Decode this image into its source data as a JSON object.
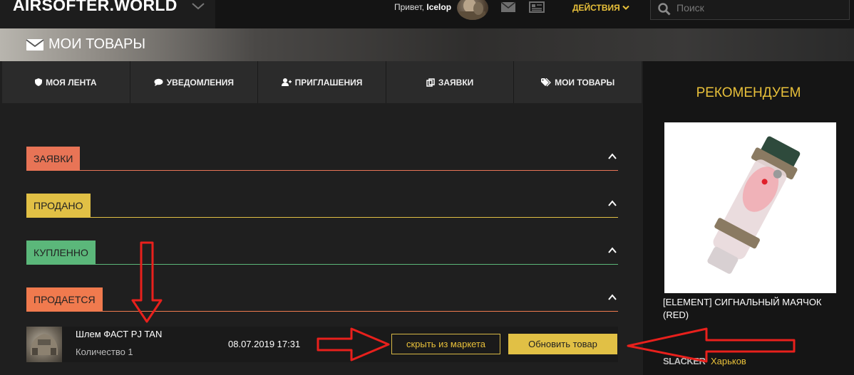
{
  "header": {
    "logo": "AIRSOFTER.WORLD",
    "greeting": "Привет,",
    "username": "Icelop",
    "actions_label": "ДЕЙСТВИЯ",
    "search_placeholder": "Поиск"
  },
  "banner": {
    "title": "МОИ ТОВАРЫ"
  },
  "tabs": [
    {
      "label": "МОЯ ЛЕНТА",
      "icon": "shield-icon"
    },
    {
      "label": "УВЕДОМЛЕНИЯ",
      "icon": "chat-icon"
    },
    {
      "label": "ПРИГЛАШЕНИЯ",
      "icon": "user-plus-icon"
    },
    {
      "label": "ЗАЯВКИ",
      "icon": "copy-icon"
    },
    {
      "label": "МОИ ТОВАРЫ",
      "icon": "tags-icon"
    }
  ],
  "sections": [
    {
      "label": "ЗАЯВКИ",
      "color": "#e87456"
    },
    {
      "label": "ПРОДАНО",
      "color": "#e1c045"
    },
    {
      "label": "КУПЛЕННО",
      "color": "#5bb77a"
    },
    {
      "label": "ПРОДАЕТСЯ",
      "color": "#f07a4e"
    }
  ],
  "item": {
    "name": "Шлем ФАСТ PJ TAN",
    "quantity": "Количество 1",
    "date": "08.07.2019 17:31",
    "hide_button": "скрыть из маркета",
    "update_button": "Обновить товар"
  },
  "sidebar": {
    "title": "РЕКОМЕНДУЕМ",
    "product_name": "[ELEMENT] СИГНАЛЬНЫЙ МАЯЧОК (RED)",
    "seller": "SLACKER",
    "city": "Харьков"
  },
  "colors": {
    "accent": "#e8c03a",
    "annotation": "#e8201c"
  }
}
